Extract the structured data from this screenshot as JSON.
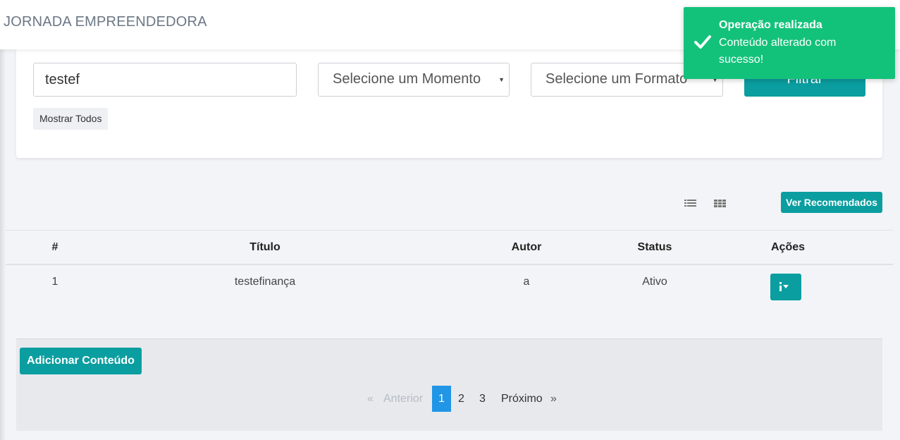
{
  "app": {
    "title": "JORNADA EMPREENDEDORA"
  },
  "filters": {
    "search_value": "testef",
    "momento_selected": "Selecione um Momento",
    "formato_selected": "Selecione um Formato",
    "filter_label": "Filtrar",
    "show_all_label": "Mostrar Todos"
  },
  "toolbar": {
    "list_view_icon": "list-icon",
    "grid_view_icon": "grid-icon",
    "recommended_label": "Ver Recomendados"
  },
  "table": {
    "headers": [
      "#",
      "Título",
      "Autor",
      "Status",
      "Ações"
    ],
    "rows": [
      {
        "num": "1",
        "titulo": "testefinança",
        "autor": "a",
        "status": "Ativo",
        "acoes_icon": "info-dropdown-icon"
      }
    ]
  },
  "footer": {
    "add_label": "Adicionar Conteúdo",
    "pagination": {
      "prev_arrow": "«",
      "prev_label": "Anterior",
      "pages": [
        "1",
        "2",
        "3"
      ],
      "active_page": "1",
      "next_label": "Próximo",
      "next_arrow": "»"
    }
  },
  "toast": {
    "icon": "check-icon",
    "title": "Operação realizada",
    "message": "Conteúdo alterado com sucesso!"
  },
  "colors": {
    "accent": "#0b9ea0",
    "toast_success": "#13c27a",
    "pagination_active": "#2196e6"
  }
}
